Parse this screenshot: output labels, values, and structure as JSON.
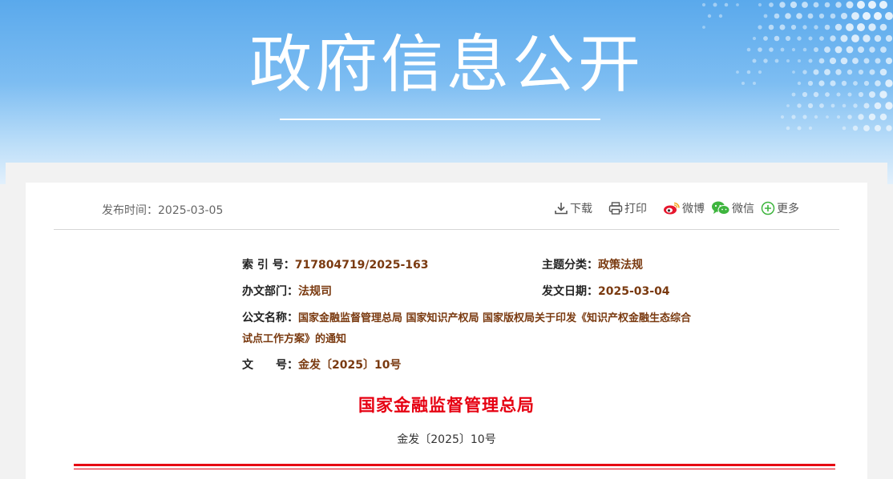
{
  "banner": {
    "title": "政府信息公开"
  },
  "meta": {
    "publish_time": "发布时间：2025-03-05",
    "tools": {
      "download": "下载",
      "print": "打印",
      "weibo": "微博",
      "wechat": "微信",
      "more": "更多"
    }
  },
  "info": {
    "index_label": "索 引 号：",
    "index_value": "717804719/2025-163",
    "topic_label": "主题分类：",
    "topic_value": "政策法规",
    "dept_label": "办文部门：",
    "dept_value": "法规司",
    "date_label": "发文日期：",
    "date_value": "2025-03-04",
    "name_label": "公文名称：",
    "name_value": "国家金融监督管理总局 国家知识产权局 国家版权局关于印发《知识产权金融生态综合试点工作方案》的通知",
    "docno_label": "文　　号：",
    "docno_value": "金发〔2025〕10号"
  },
  "document": {
    "issuer": "国家金融监督管理总局",
    "doc_number": "金发〔2025〕10号"
  },
  "colors": {
    "banner_top": "#5aa9ec",
    "accent_red": "#e60012",
    "value_brown": "#7a3a10"
  }
}
